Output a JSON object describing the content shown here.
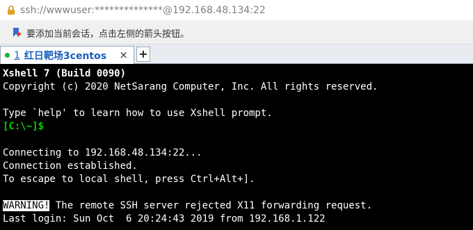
{
  "address_bar": {
    "url": "ssh://wwwuser:**************@192.168.48.134:22"
  },
  "hint_bar": {
    "text": "要添加当前会话，点击左侧的箭头按钮。"
  },
  "tabs": [
    {
      "number": "1",
      "title": "红日靶场3centos",
      "close": "×",
      "status_color": "#15b43a"
    }
  ],
  "new_tab_label": "+",
  "terminal": {
    "lines": {
      "l0": "Xshell 7 (Build 0090)",
      "l1": "Copyright (c) 2020 NetSarang Computer, Inc. All rights reserved.",
      "l3": "Type `help' to learn how to use Xshell prompt.",
      "l4": "[C:\\~]$",
      "l6": "Connecting to 192.168.48.134:22...",
      "l7": "Connection established.",
      "l8": "To escape to local shell, press Ctrl+Alt+].",
      "l10_warn": "WARNING!",
      "l10_rest": " The remote SSH server rejected X11 forwarding request.",
      "l11": "Last login: Sun Oct  6 20:24:43 2019 from 192.168.1.122"
    }
  }
}
